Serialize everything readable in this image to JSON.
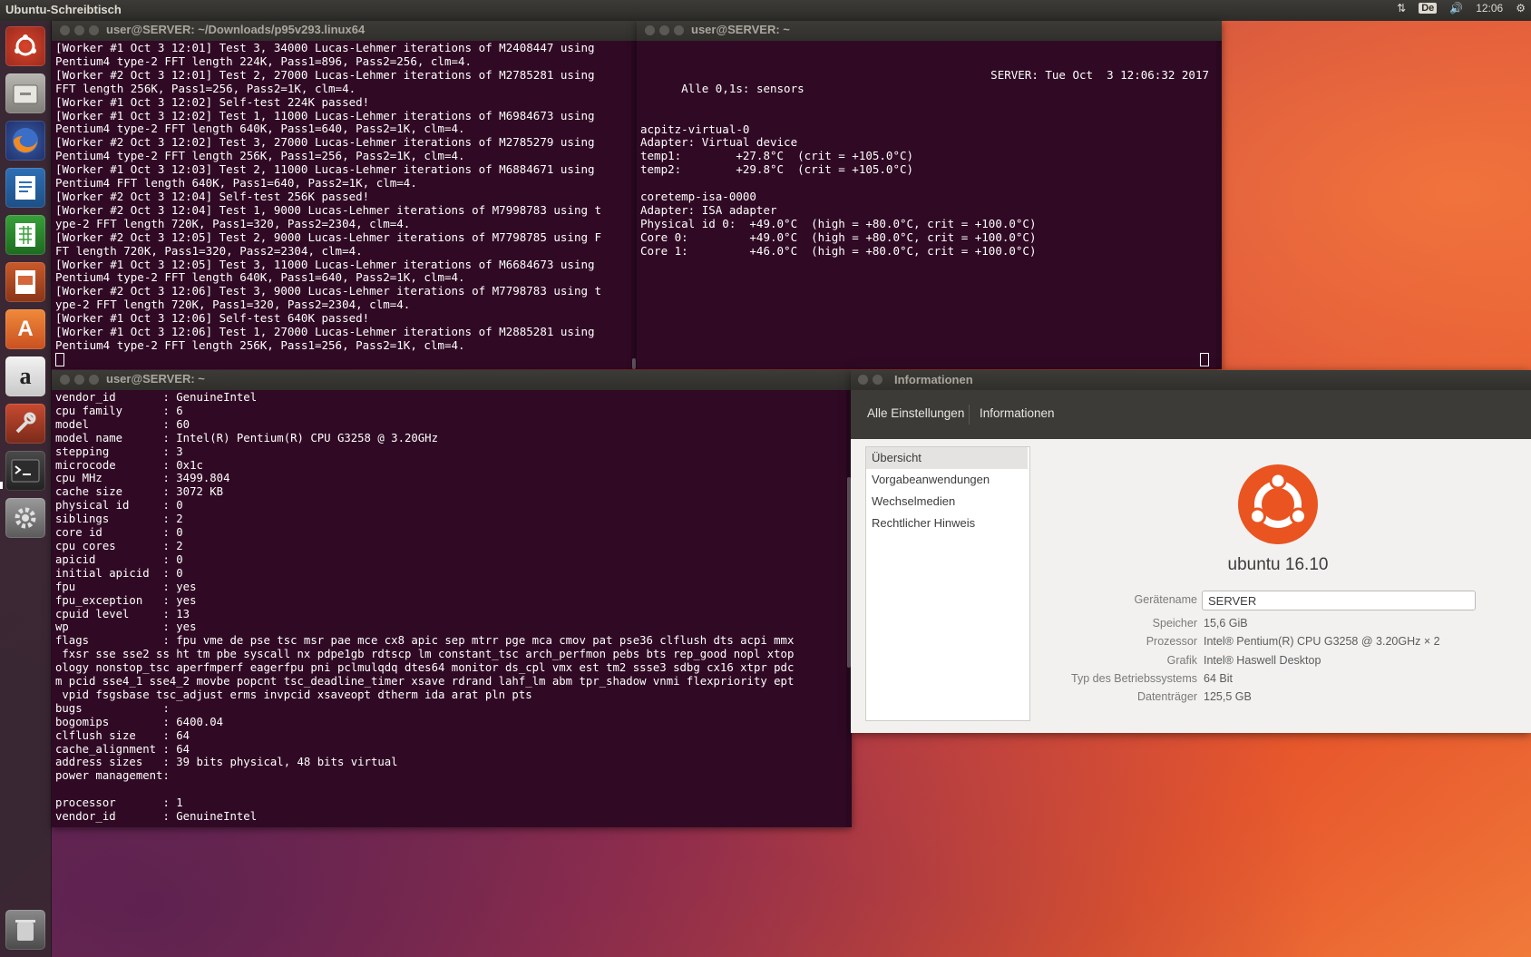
{
  "panel": {
    "title": "Ubuntu-Schreibtisch",
    "keyboard_layout": "De",
    "clock": "12:06"
  },
  "launcher": {
    "items": [
      "dash-home",
      "files",
      "firefox",
      "writer",
      "calc",
      "impress",
      "software-center",
      "amazon",
      "system-tools",
      "terminal",
      "system-settings",
      "trash"
    ]
  },
  "terminal1": {
    "title": "user@SERVER: ~/Downloads/p95v293.linux64",
    "lines": [
      "[Worker #1 Oct 3 12:01] Test 3, 34000 Lucas-Lehmer iterations of M2408447 using",
      "Pentium4 type-2 FFT length 224K, Pass1=896, Pass2=256, clm=4.",
      "[Worker #2 Oct 3 12:01] Test 2, 27000 Lucas-Lehmer iterations of M2785281 using",
      "FFT length 256K, Pass1=256, Pass2=1K, clm=4.",
      "[Worker #1 Oct 3 12:02] Self-test 224K passed!",
      "[Worker #1 Oct 3 12:02] Test 1, 11000 Lucas-Lehmer iterations of M6984673 using",
      "Pentium4 type-2 FFT length 640K, Pass1=640, Pass2=1K, clm=4.",
      "[Worker #2 Oct 3 12:02] Test 3, 27000 Lucas-Lehmer iterations of M2785279 using",
      "Pentium4 type-2 FFT length 256K, Pass1=256, Pass2=1K, clm=4.",
      "[Worker #1 Oct 3 12:03] Test 2, 11000 Lucas-Lehmer iterations of M6884671 using",
      "Pentium4 FFT length 640K, Pass1=640, Pass2=1K, clm=4.",
      "[Worker #2 Oct 3 12:04] Self-test 256K passed!",
      "[Worker #2 Oct 3 12:04] Test 1, 9000 Lucas-Lehmer iterations of M7998783 using t",
      "ype-2 FFT length 720K, Pass1=320, Pass2=2304, clm=4.",
      "[Worker #2 Oct 3 12:05] Test 2, 9000 Lucas-Lehmer iterations of M7798785 using F",
      "FT length 720K, Pass1=320, Pass2=2304, clm=4.",
      "[Worker #1 Oct 3 12:05] Test 3, 11000 Lucas-Lehmer iterations of M6684673 using",
      "Pentium4 type-2 FFT length 640K, Pass1=640, Pass2=1K, clm=4.",
      "[Worker #2 Oct 3 12:06] Test 3, 9000 Lucas-Lehmer iterations of M7798783 using t",
      "ype-2 FFT length 720K, Pass1=320, Pass2=2304, clm=4.",
      "[Worker #1 Oct 3 12:06] Self-test 640K passed!",
      "[Worker #1 Oct 3 12:06] Test 1, 27000 Lucas-Lehmer iterations of M2885281 using",
      "Pentium4 type-2 FFT length 256K, Pass1=256, Pass2=1K, clm=4."
    ]
  },
  "terminal2": {
    "title": "user@SERVER: ~",
    "header_left": "Alle 0,1s: sensors",
    "header_right": "SERVER: Tue Oct  3 12:06:32 2017",
    "lines": [
      "",
      "acpitz-virtual-0",
      "Adapter: Virtual device",
      "temp1:        +27.8°C  (crit = +105.0°C)",
      "temp2:        +29.8°C  (crit = +105.0°C)",
      "",
      "coretemp-isa-0000",
      "Adapter: ISA adapter",
      "Physical id 0:  +49.0°C  (high = +80.0°C, crit = +100.0°C)",
      "Core 0:         +49.0°C  (high = +80.0°C, crit = +100.0°C)",
      "Core 1:         +46.0°C  (high = +80.0°C, crit = +100.0°C)"
    ]
  },
  "terminal3": {
    "title": "user@SERVER: ~",
    "lines": [
      "vendor_id       : GenuineIntel",
      "cpu family      : 6",
      "model           : 60",
      "model name      : Intel(R) Pentium(R) CPU G3258 @ 3.20GHz",
      "stepping        : 3",
      "microcode       : 0x1c",
      "cpu MHz         : 3499.804",
      "cache size      : 3072 KB",
      "physical id     : 0",
      "siblings        : 2",
      "core id         : 0",
      "cpu cores       : 2",
      "apicid          : 0",
      "initial apicid  : 0",
      "fpu             : yes",
      "fpu_exception   : yes",
      "cpuid level     : 13",
      "wp              : yes",
      "flags           : fpu vme de pse tsc msr pae mce cx8 apic sep mtrr pge mca cmov pat pse36 clflush dts acpi mmx",
      " fxsr sse sse2 ss ht tm pbe syscall nx pdpe1gb rdtscp lm constant_tsc arch_perfmon pebs bts rep_good nopl xtop",
      "ology nonstop_tsc aperfmperf eagerfpu pni pclmulqdq dtes64 monitor ds_cpl vmx est tm2 ssse3 sdbg cx16 xtpr pdc",
      "m pcid sse4_1 sse4_2 movbe popcnt tsc_deadline_timer xsave rdrand lahf_lm abm tpr_shadow vnmi flexpriority ept",
      " vpid fsgsbase tsc_adjust erms invpcid xsaveopt dtherm ida arat pln pts",
      "bugs            :",
      "bogomips        : 6400.04",
      "clflush size    : 64",
      "cache_alignment : 64",
      "address sizes   : 39 bits physical, 48 bits virtual",
      "power management:",
      "",
      "processor       : 1",
      "vendor_id       : GenuineIntel"
    ]
  },
  "info_window": {
    "title": "Informationen",
    "breadcrumb_all": "Alle Einstellungen",
    "breadcrumb_current": "Informationen",
    "sidebar": [
      "Übersicht",
      "Vorgabeanwendungen",
      "Wechselmedien",
      "Rechtlicher Hinweis"
    ],
    "distro": "ubuntu 16.10",
    "device_name_label": "Gerätename",
    "device_name_value": "SERVER",
    "rows": [
      {
        "label": "Speicher",
        "value": "15,6 GiB"
      },
      {
        "label": "Prozessor",
        "value": "Intel® Pentium(R) CPU G3258 @ 3.20GHz × 2"
      },
      {
        "label": "Grafik",
        "value": "Intel® Haswell Desktop"
      },
      {
        "label": "Typ des Betriebssystems",
        "value": "64 Bit"
      },
      {
        "label": "Datenträger",
        "value": "125,5 GB"
      }
    ]
  },
  "colors": {
    "terminal_bg": "#300a24",
    "ubuntu_orange": "#e95420",
    "panel_bg": "#3c3b37"
  }
}
